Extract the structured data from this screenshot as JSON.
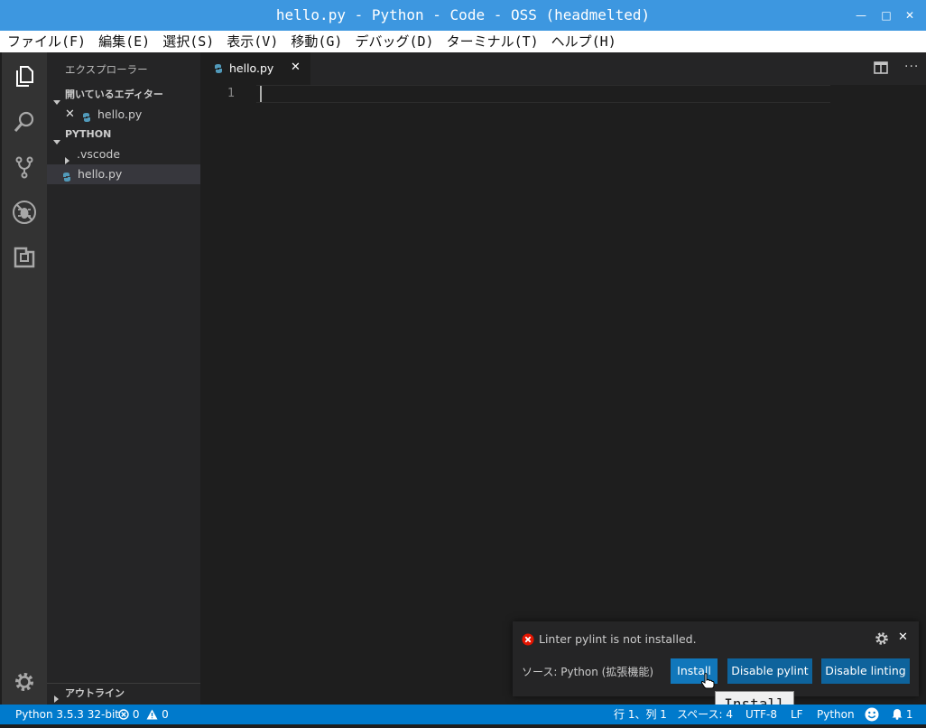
{
  "window": {
    "title": "hello.py - Python - Code - OSS (headmelted)",
    "minimize": "—",
    "maximize": "□",
    "close": "✕"
  },
  "menu": [
    "ファイル(F)",
    "編集(E)",
    "選択(S)",
    "表示(V)",
    "移動(G)",
    "デバッグ(D)",
    "ターミナル(T)",
    "ヘルプ(H)"
  ],
  "activity_bar": {
    "icons": [
      "files-icon",
      "search-icon",
      "source-control-icon",
      "debug-icon",
      "extensions-icon"
    ],
    "bottom_icon": "gear-icon"
  },
  "sidebar": {
    "title": "エクスプローラー",
    "open_editors": {
      "header": "開いているエディター",
      "items": [
        {
          "label": "hello.py"
        }
      ]
    },
    "folder": {
      "header": "PYTHON",
      "items": [
        {
          "label": ".vscode",
          "type": "folder"
        },
        {
          "label": "hello.py",
          "type": "file"
        }
      ]
    },
    "outline": "アウトライン"
  },
  "editor": {
    "tab_label": "hello.py",
    "line_numbers": [
      "1"
    ]
  },
  "notification": {
    "message": "Linter pylint is not installed.",
    "source": "ソース: Python (拡張機能)",
    "buttons": {
      "install": "Install",
      "disable_pylint": "Disable pylint",
      "disable_linting": "Disable linting"
    },
    "tooltip": "Install"
  },
  "status_bar": {
    "interpreter": "Python 3.5.3 32-bit",
    "errors": "0",
    "warnings": "0",
    "position": "行 1、列 1",
    "indent": "スペース: 4",
    "encoding": "UTF-8",
    "eol": "LF",
    "language": "Python",
    "notifications": "1"
  },
  "colors": {
    "title_bar": "#3d97e0",
    "accent": "#007acc",
    "button": "#0e639c",
    "python_icon": "#519aba",
    "error": "#e51400"
  }
}
